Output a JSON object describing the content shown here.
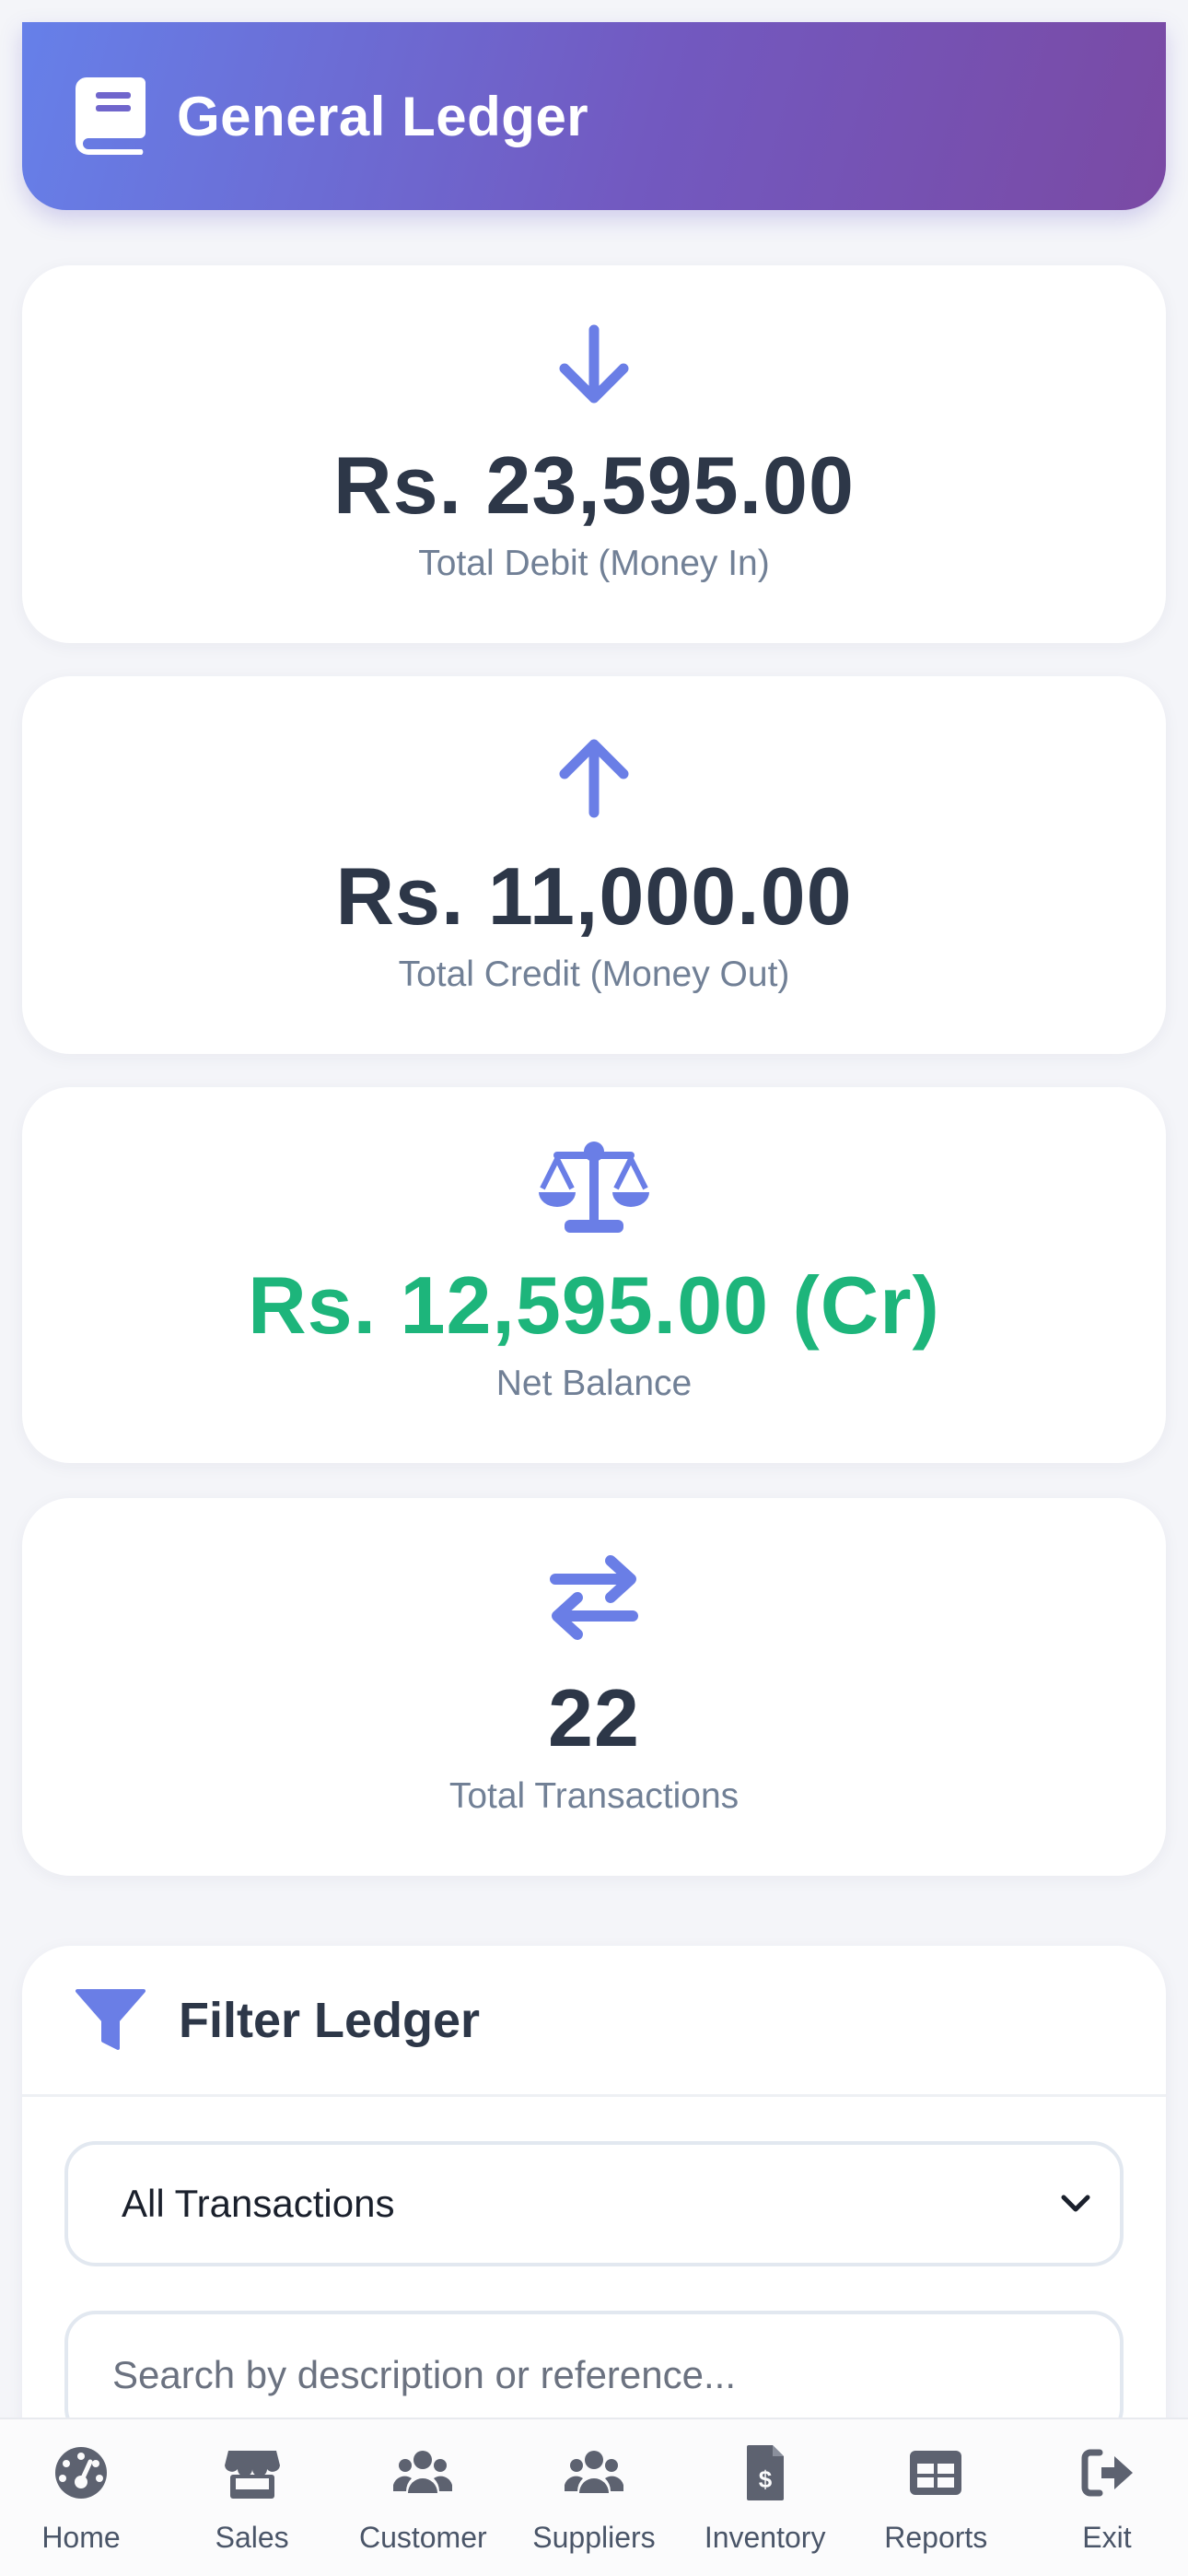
{
  "header": {
    "title": "General Ledger",
    "icon": "book-icon",
    "gradient": [
      "#6680e9",
      "#7a4aa4"
    ]
  },
  "stats": [
    {
      "icon": "arrow-down-icon",
      "value": "Rs. 23,595.00",
      "label": "Total Debit (Money In)"
    },
    {
      "icon": "arrow-up-icon",
      "value": "Rs. 11,000.00",
      "label": "Total Credit (Money Out)"
    },
    {
      "icon": "balance-scale-icon",
      "value": "Rs. 12,595.00 (Cr)",
      "label": "Net Balance",
      "value_color": "#1db57b"
    },
    {
      "icon": "exchange-arrows-icon",
      "value": "22",
      "label": "Total Transactions"
    }
  ],
  "filter": {
    "title": "Filter Ledger",
    "icon": "filter-funnel-icon",
    "type_select": {
      "selected": "All Transactions"
    },
    "search": {
      "placeholder": "Search by description or reference..."
    }
  },
  "bottom_nav": {
    "items": [
      {
        "label": "Home",
        "icon": "gauge-icon"
      },
      {
        "label": "Sales",
        "icon": "store-icon"
      },
      {
        "label": "Customer",
        "icon": "users-icon"
      },
      {
        "label": "Suppliers",
        "icon": "users-icon"
      },
      {
        "label": "Inventory",
        "icon": "invoice-dollar-icon"
      },
      {
        "label": "Reports",
        "icon": "table-icon"
      },
      {
        "label": "Exit",
        "icon": "sign-out-icon"
      }
    ]
  },
  "colors": {
    "accent": "#6a7ee6",
    "positive": "#1db57b",
    "text": "#2d3748",
    "muted": "#718096"
  }
}
